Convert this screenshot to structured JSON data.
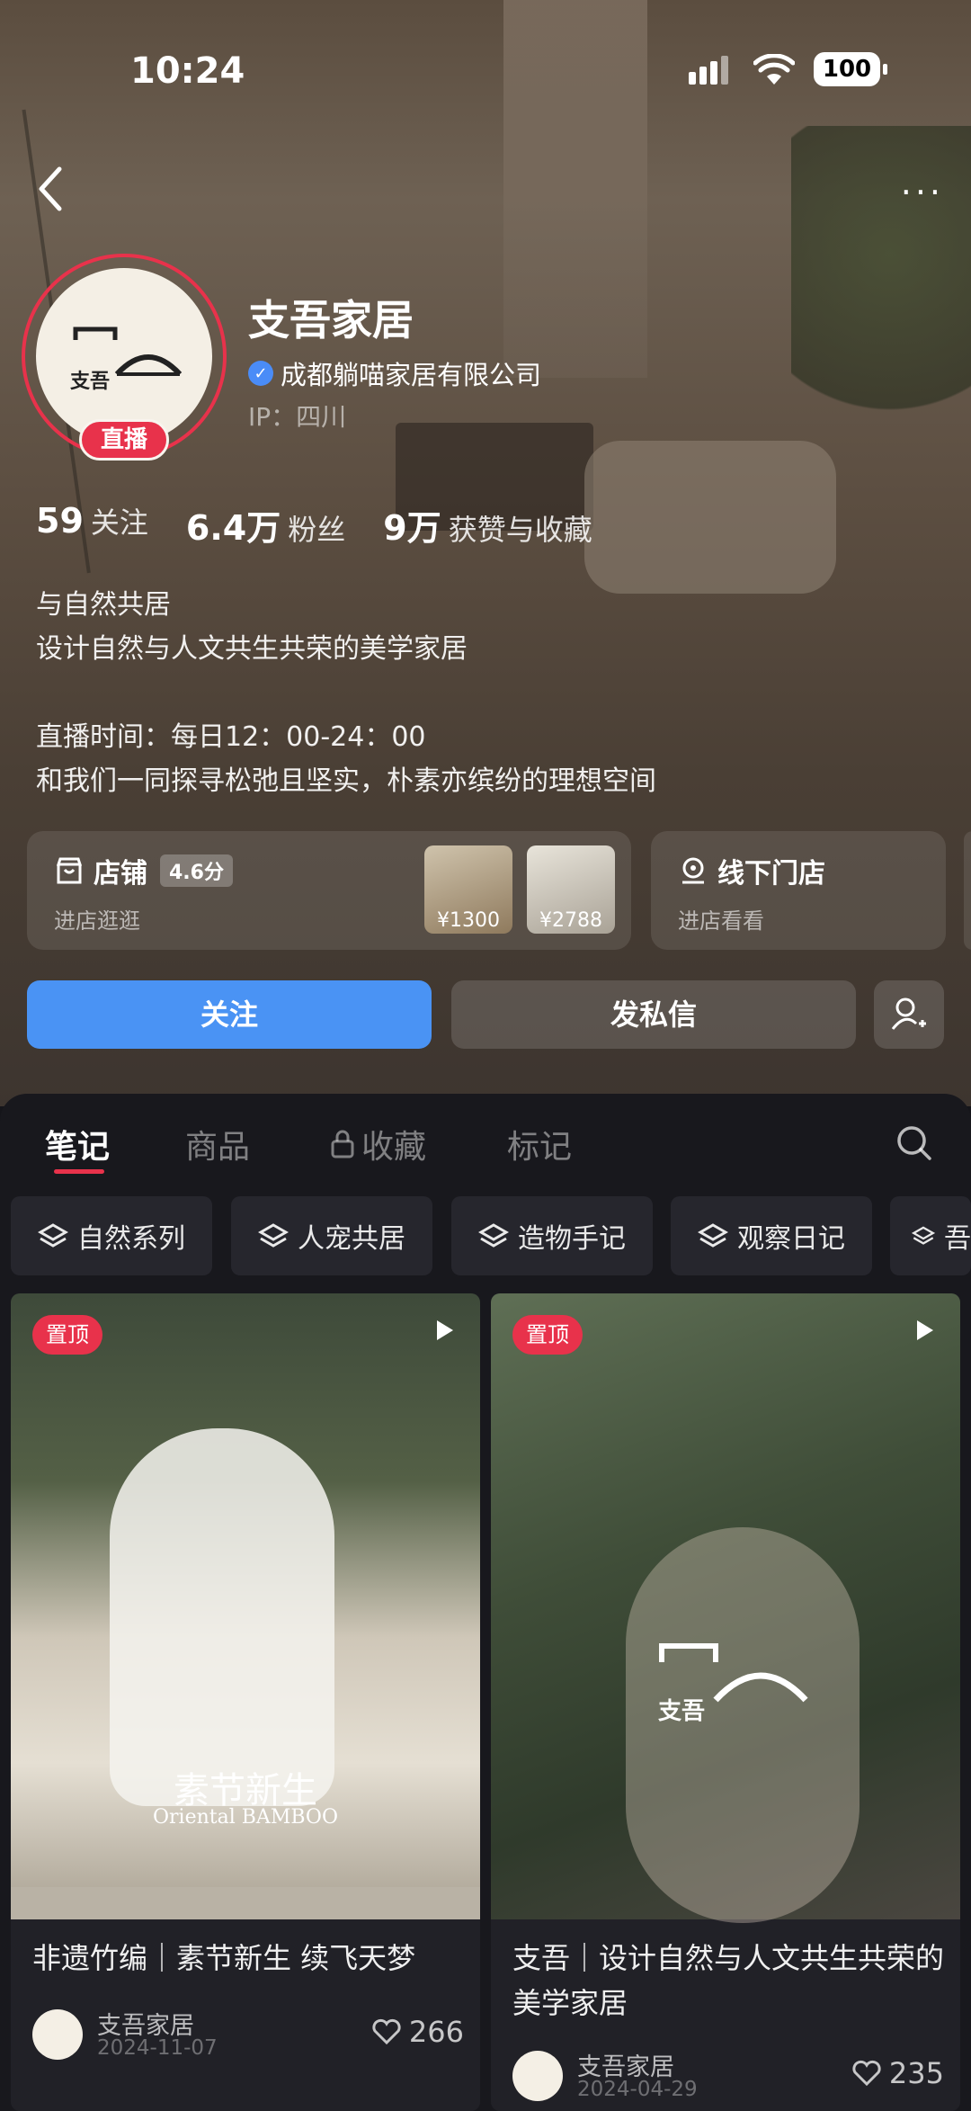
{
  "status": {
    "time": "10:24",
    "battery": "100"
  },
  "profile": {
    "name": "支吾家居",
    "verified_company": "成都躺喵家居有限公司",
    "ip": "IP：四川",
    "live_badge": "直播",
    "avatar_text": "支吾"
  },
  "stats": [
    {
      "value": "59",
      "label": "关注"
    },
    {
      "value": "6.4万",
      "label": "粉丝"
    },
    {
      "value": "9万",
      "label": "获赞与收藏"
    }
  ],
  "bio": "与自然共居\n设计自然与人文共生共荣的美学家居\n\n直播时间：每日12：00-24：00\n和我们一同探寻松弛且坚实，朴素亦缤纷的理想空间",
  "shop": {
    "title": "店铺",
    "score": "4.6分",
    "subtitle": "进店逛逛",
    "prices": [
      "¥1300",
      "¥2788"
    ]
  },
  "store": {
    "title": "线下门店",
    "subtitle": "进店看看"
  },
  "actions": {
    "follow": "关注",
    "message": "发私信"
  },
  "tabs": [
    "笔记",
    "商品",
    "收藏",
    "标记"
  ],
  "chips": [
    "自然系列",
    "人宠共居",
    "造物手记",
    "观察日记",
    "吾"
  ],
  "notes": [
    {
      "pin": "置顶",
      "title": "非遗竹编｜素节新生 续飞天梦",
      "author": "支吾家居",
      "date": "2024-11-07",
      "likes": "266",
      "overlay": "素节新生",
      "overlay_sub": "Oriental BAMBOO"
    },
    {
      "pin": "置顶",
      "title": "支吾｜设计自然与人文共生共荣的美学家居",
      "author": "支吾家居",
      "date": "2024-04-29",
      "likes": "235",
      "overlay": "支吾"
    }
  ],
  "colors": {
    "accent_red": "#e8324b",
    "follow_blue": "#4a93f4",
    "panel_bg": "#18181d"
  }
}
